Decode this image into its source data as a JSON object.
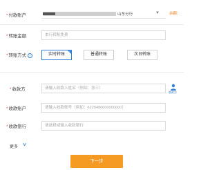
{
  "payer_account": {
    "label": "付款账户",
    "branch": "山东分行",
    "dropdown_glyph": "▼",
    "balance_link": "余额："
  },
  "transfer_amount": {
    "label": "转账金额",
    "placeholder": "本行转账免费"
  },
  "transfer_method": {
    "label": "转账方式",
    "info_glyph": "i",
    "options": [
      {
        "label": "实时转账",
        "selected": true
      },
      {
        "label": "普通转账",
        "selected": false
      },
      {
        "label": "次日转账",
        "selected": false
      }
    ],
    "check_glyph": "✓"
  },
  "payee": {
    "label": "收款方",
    "placeholder": "请输入收款人姓名（例如：张三）",
    "contacts_label": "收款方"
  },
  "payee_account": {
    "label": "收款账户",
    "placeholder": "请输入收款账号（例如：6228480000000000）"
  },
  "payee_bank": {
    "label": "收款银行",
    "placeholder": "请选择或输入收款银行"
  },
  "more": {
    "label": "更多",
    "glyph": "∨"
  },
  "next_button": {
    "label": "下一步"
  },
  "required_mark": "*",
  "colors": {
    "accent": "#2f7ed8",
    "button": "#f59a23",
    "required": "#e0453a",
    "balance": "#f08a24"
  }
}
